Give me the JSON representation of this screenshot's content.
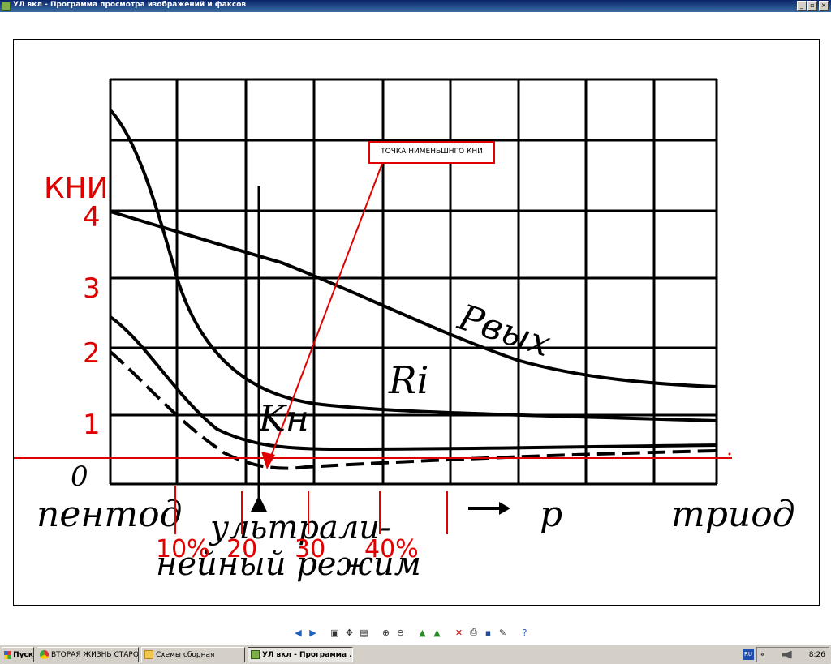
{
  "window": {
    "title": "УЛ  вкл - Программа просмотра изображений и факсов",
    "minimize": "_",
    "maximize": "▫",
    "close": "×"
  },
  "chart_data": {
    "type": "line",
    "x_axis_text_left": "пентод",
    "x_axis_text_right": "триод",
    "x_axis_arrow_text": "p",
    "x_axis_text_center": [
      "ультрали-",
      "нейный режим"
    ],
    "y_axis_printed_labels": [
      "0",
      "1",
      "2",
      "3",
      "4"
    ],
    "y_title_handwritten": "КНИ",
    "percent_marks": [
      "10%",
      "20",
      "30",
      "40%"
    ],
    "curve_labels": [
      "Pвых",
      "Ri",
      "Kн"
    ],
    "annotation": "ТОЧКА  НИМЕНЬШНГО  КНИ"
  },
  "toolbar": {
    "icons": [
      "prev-icon",
      "next-icon",
      "best-fit-icon",
      "actual-size-icon",
      "slideshow-icon",
      "zoom-in-icon",
      "zoom-out-icon",
      "rotate-clockwise-icon",
      "rotate-counterclockwise-icon",
      "delete-icon",
      "print-icon",
      "save-icon",
      "edit-icon",
      "help-icon"
    ]
  },
  "taskbar": {
    "start_label": "Пуск",
    "tasks": [
      {
        "label": "ВТОРАЯ ЖИЗНЬ СТАРО...",
        "icon": "chrome-icon"
      },
      {
        "label": "Схемы сборная",
        "icon": "folder-icon"
      },
      {
        "label": "УЛ  вкл - Программа ...",
        "icon": "image-viewer-icon",
        "active": true
      }
    ],
    "lang": "RU",
    "tray_arrow": "«",
    "clock": "8:26"
  }
}
